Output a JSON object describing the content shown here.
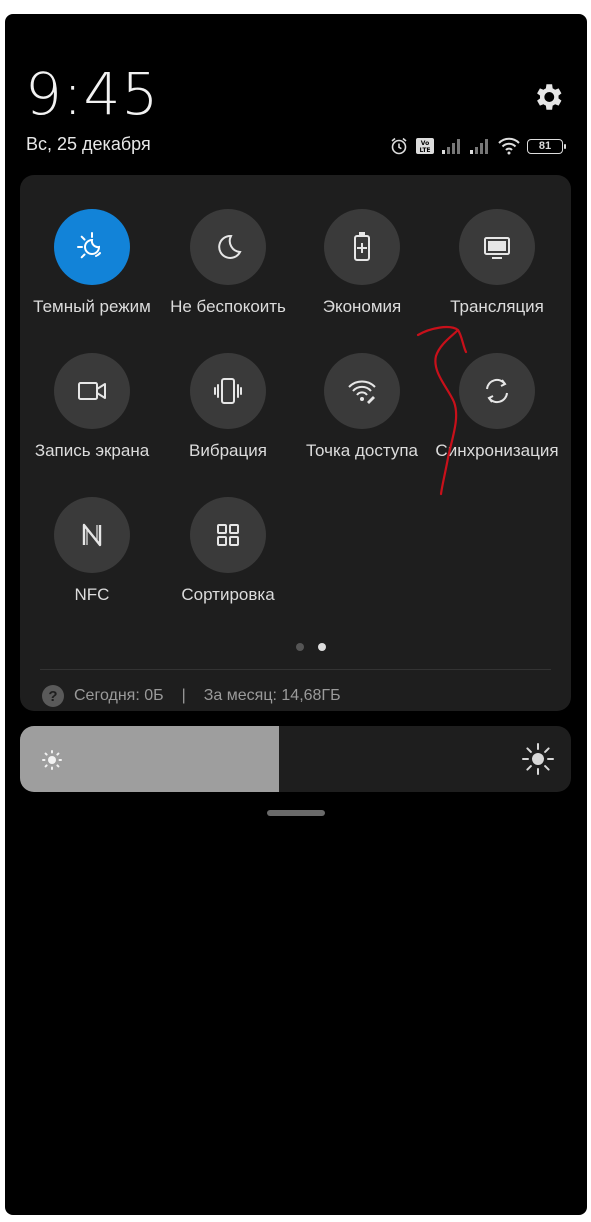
{
  "clock": {
    "time": "9:45"
  },
  "date": "Вс, 25 декабря",
  "status": {
    "battery": "81"
  },
  "tiles": [
    {
      "label": "Темный режим",
      "icon": "dark-mode-icon",
      "active": true
    },
    {
      "label": "Не беспокоить",
      "icon": "moon-icon",
      "active": false
    },
    {
      "label": "Экономия",
      "icon": "battery-saver-icon",
      "active": false
    },
    {
      "label": "Трансляция",
      "icon": "monitor-icon",
      "active": false
    },
    {
      "label": "Запись экрана",
      "icon": "video-camera-icon",
      "active": false
    },
    {
      "label": "Вибрация",
      "icon": "vibration-icon",
      "active": false
    },
    {
      "label": "Точка доступа",
      "icon": "hotspot-icon",
      "active": false
    },
    {
      "label": "Синхронизация",
      "icon": "sync-icon",
      "active": false
    },
    {
      "label": "NFC",
      "icon": "nfc-icon",
      "active": false
    },
    {
      "label": "Сортировка",
      "icon": "grid-icon",
      "active": false
    }
  ],
  "pager": {
    "pages": 2,
    "current": 2
  },
  "usage": {
    "today": "Сегодня: 0Б",
    "separator": "|",
    "month": "За месяц: 14,68ГБ"
  },
  "brightness": {
    "level": 0.47
  },
  "colors": {
    "accent": "#1283d8",
    "panel": "#1e1e1e",
    "tile": "#3a3a3a",
    "annotation": "#c8101a"
  }
}
